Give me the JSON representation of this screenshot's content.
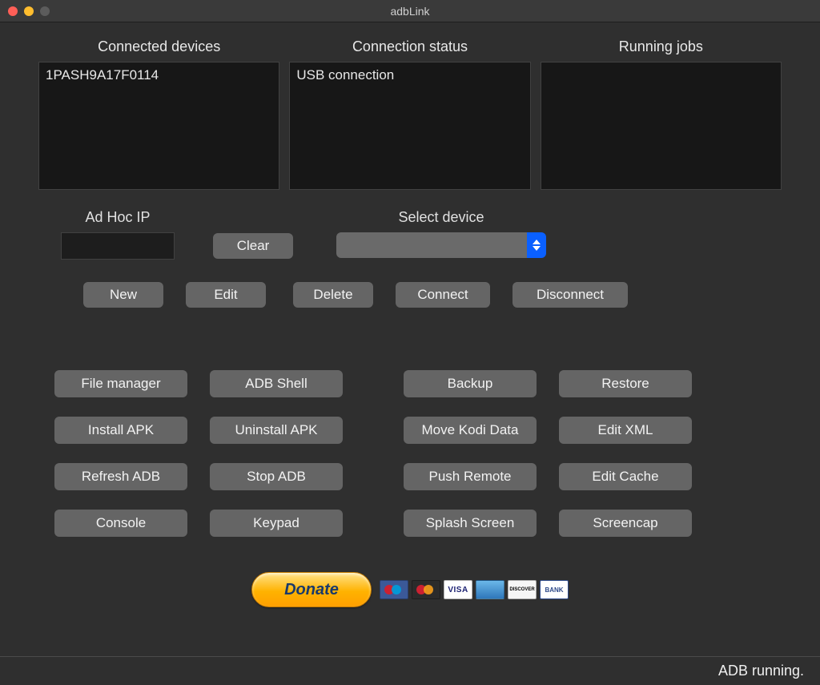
{
  "window": {
    "title": "adbLink"
  },
  "panels": {
    "connected_devices": {
      "label": "Connected devices",
      "items": [
        "1PASH9A17F0114"
      ]
    },
    "connection_status": {
      "label": "Connection status",
      "items": [
        "USB connection"
      ]
    },
    "running_jobs": {
      "label": "Running jobs",
      "items": []
    }
  },
  "adhoc": {
    "label": "Ad Hoc IP",
    "value": "",
    "clear": "Clear"
  },
  "device_select": {
    "label": "Select device",
    "selected": ""
  },
  "device_buttons": {
    "new": "New",
    "edit": "Edit",
    "delete": "Delete",
    "connect": "Connect",
    "disconnect": "Disconnect"
  },
  "tools": {
    "file_manager": "File manager",
    "adb_shell": "ADB Shell",
    "backup": "Backup",
    "restore": "Restore",
    "install_apk": "Install APK",
    "uninstall_apk": "Uninstall APK",
    "move_kodi_data": "Move Kodi Data",
    "edit_xml": "Edit XML",
    "refresh_adb": "Refresh ADB",
    "stop_adb": "Stop ADB",
    "push_remote": "Push Remote",
    "edit_cache": "Edit Cache",
    "console": "Console",
    "keypad": "Keypad",
    "splash_screen": "Splash Screen",
    "screencap": "Screencap"
  },
  "donate": {
    "label": "Donate"
  },
  "cards": {
    "visa": "VISA",
    "discover": "DISCOVER",
    "bank": "BANK"
  },
  "status": {
    "text": "ADB running."
  }
}
